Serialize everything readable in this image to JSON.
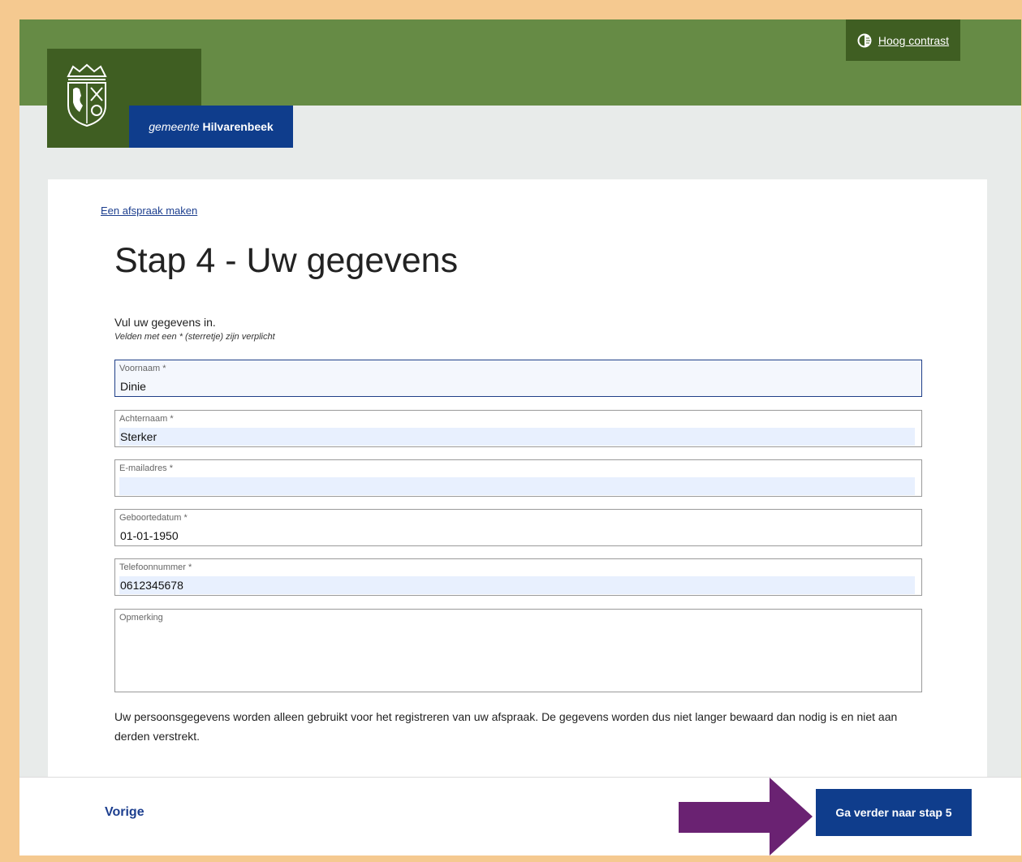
{
  "header": {
    "contrast_label": "Hoog contrast",
    "brand_prefix": "gemeente",
    "brand_name": "Hilvarenbeek"
  },
  "breadcrumb": "Een afspraak maken",
  "page_title": "Stap 4 - Uw gegevens",
  "intro": "Vul uw gegevens in.",
  "required_note": "Velden met een * (sterretje) zijn verplicht",
  "fields": {
    "voornaam": {
      "label": "Voornaam *",
      "value": "Dinie"
    },
    "achternaam": {
      "label": "Achternaam *",
      "value": "Sterker"
    },
    "email": {
      "label": "E-mailadres *",
      "value": ""
    },
    "geboortedatum": {
      "label": "Geboortedatum *",
      "value": "01-01-1950"
    },
    "telefoon": {
      "label": "Telefoonnummer *",
      "value": "0612345678"
    },
    "opmerking": {
      "label": "Opmerking",
      "value": ""
    }
  },
  "privacy_text": "Uw persoonsgegevens worden alleen gebruikt voor het registreren van uw afspraak. De gegevens worden dus niet langer bewaard dan nodig is en niet aan derden verstrekt.",
  "footer": {
    "prev_label": "Vorige",
    "next_label": "Ga verder naar stap 5"
  },
  "colors": {
    "header_green": "#668b45",
    "dark_green": "#3f5e22",
    "brand_blue": "#0f3d8c",
    "arrow_purple": "#6a2272",
    "outer_border": "#f5c990"
  },
  "icons": {
    "contrast": "contrast-icon",
    "crest": "coat-of-arms-icon",
    "arrow": "arrow-right-icon"
  }
}
